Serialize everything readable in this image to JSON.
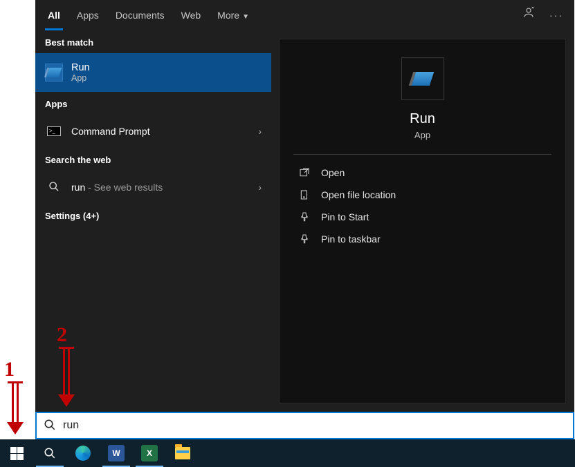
{
  "tabs": {
    "all": "All",
    "apps": "Apps",
    "documents": "Documents",
    "web": "Web",
    "more": "More"
  },
  "sections": {
    "best_match": "Best match",
    "apps": "Apps",
    "search_web": "Search the web",
    "settings": "Settings (4+)"
  },
  "best": {
    "title": "Run",
    "subtitle": "App"
  },
  "apps_list": {
    "cmd": "Command Prompt"
  },
  "web": {
    "query": "run",
    "suffix": " - See web results"
  },
  "preview": {
    "title": "Run",
    "subtitle": "App"
  },
  "actions": {
    "open": "Open",
    "open_loc": "Open file location",
    "pin_start": "Pin to Start",
    "pin_taskbar": "Pin to taskbar"
  },
  "search": {
    "value": "run"
  },
  "annotations": {
    "one": "1",
    "two": "2"
  }
}
